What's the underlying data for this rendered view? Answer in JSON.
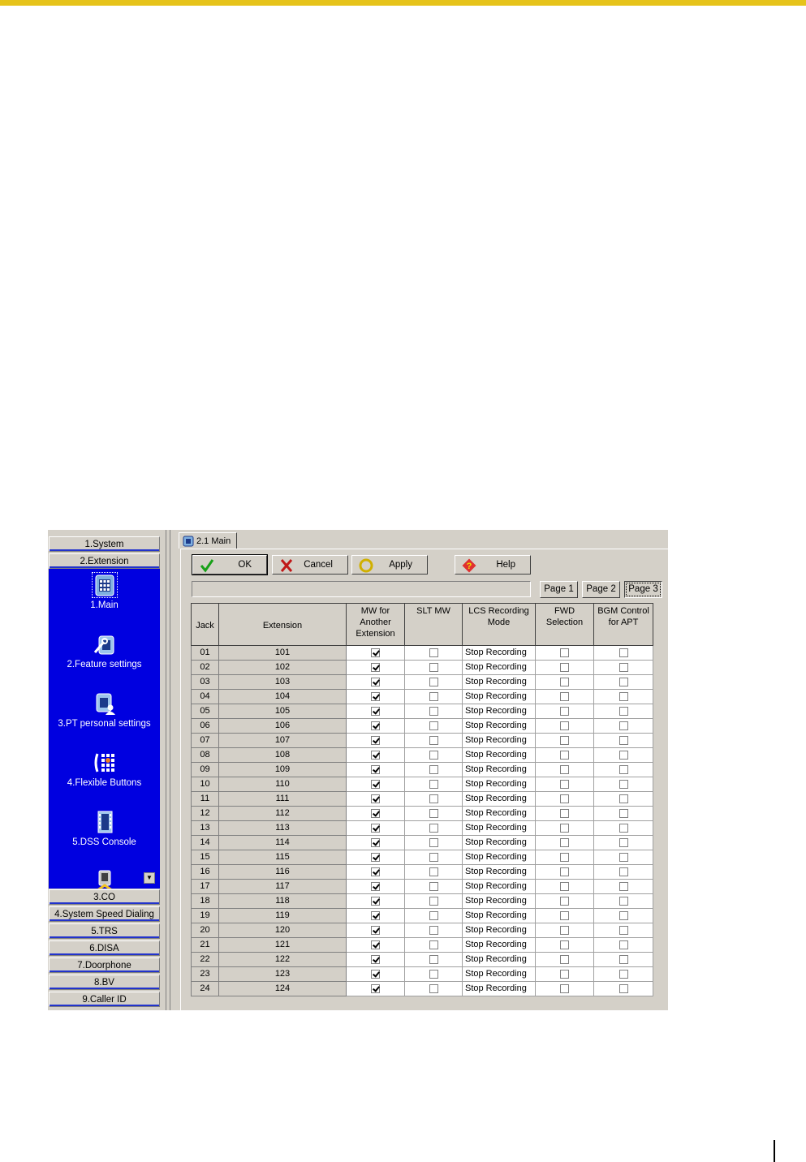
{
  "nav": {
    "top_items": [
      "1.System",
      "2.Extension"
    ],
    "sub_items": [
      "1.Main",
      "2.Feature settings",
      "3.PT personal settings",
      "4.Flexible Buttons",
      "5.DSS Console"
    ],
    "bottom_items": [
      "3.CO",
      "4.System Speed Dialing",
      "5.TRS",
      "6.DISA",
      "7.Doorphone",
      "8.BV",
      "9.Caller ID"
    ]
  },
  "tab": {
    "label": "2.1 Main"
  },
  "toolbar": {
    "ok": "OK",
    "cancel": "Cancel",
    "apply": "Apply",
    "help": "Help"
  },
  "pages": [
    "Page 1",
    "Page 2",
    "Page 3"
  ],
  "table": {
    "headers": [
      "Jack",
      "Extension",
      "MW for Another Extension",
      "SLT MW",
      "LCS Recording Mode",
      "FWD Selection",
      "BGM Control for APT"
    ],
    "rows": [
      {
        "jack": "01",
        "ext": "101",
        "mw": true,
        "slt": false,
        "lcs": "Stop Recording",
        "fwd": false,
        "bgm": false
      },
      {
        "jack": "02",
        "ext": "102",
        "mw": true,
        "slt": false,
        "lcs": "Stop Recording",
        "fwd": false,
        "bgm": false
      },
      {
        "jack": "03",
        "ext": "103",
        "mw": true,
        "slt": false,
        "lcs": "Stop Recording",
        "fwd": false,
        "bgm": false
      },
      {
        "jack": "04",
        "ext": "104",
        "mw": true,
        "slt": false,
        "lcs": "Stop Recording",
        "fwd": false,
        "bgm": false
      },
      {
        "jack": "05",
        "ext": "105",
        "mw": true,
        "slt": false,
        "lcs": "Stop Recording",
        "fwd": false,
        "bgm": false
      },
      {
        "jack": "06",
        "ext": "106",
        "mw": true,
        "slt": false,
        "lcs": "Stop Recording",
        "fwd": false,
        "bgm": false
      },
      {
        "jack": "07",
        "ext": "107",
        "mw": true,
        "slt": false,
        "lcs": "Stop Recording",
        "fwd": false,
        "bgm": false
      },
      {
        "jack": "08",
        "ext": "108",
        "mw": true,
        "slt": false,
        "lcs": "Stop Recording",
        "fwd": false,
        "bgm": false
      },
      {
        "jack": "09",
        "ext": "109",
        "mw": true,
        "slt": false,
        "lcs": "Stop Recording",
        "fwd": false,
        "bgm": false
      },
      {
        "jack": "10",
        "ext": "110",
        "mw": true,
        "slt": false,
        "lcs": "Stop Recording",
        "fwd": false,
        "bgm": false
      },
      {
        "jack": "11",
        "ext": "111",
        "mw": true,
        "slt": false,
        "lcs": "Stop Recording",
        "fwd": false,
        "bgm": false
      },
      {
        "jack": "12",
        "ext": "112",
        "mw": true,
        "slt": false,
        "lcs": "Stop Recording",
        "fwd": false,
        "bgm": false
      },
      {
        "jack": "13",
        "ext": "113",
        "mw": true,
        "slt": false,
        "lcs": "Stop Recording",
        "fwd": false,
        "bgm": false
      },
      {
        "jack": "14",
        "ext": "114",
        "mw": true,
        "slt": false,
        "lcs": "Stop Recording",
        "fwd": false,
        "bgm": false
      },
      {
        "jack": "15",
        "ext": "115",
        "mw": true,
        "slt": false,
        "lcs": "Stop Recording",
        "fwd": false,
        "bgm": false
      },
      {
        "jack": "16",
        "ext": "116",
        "mw": true,
        "slt": false,
        "lcs": "Stop Recording",
        "fwd": false,
        "bgm": false
      },
      {
        "jack": "17",
        "ext": "117",
        "mw": true,
        "slt": false,
        "lcs": "Stop Recording",
        "fwd": false,
        "bgm": false
      },
      {
        "jack": "18",
        "ext": "118",
        "mw": true,
        "slt": false,
        "lcs": "Stop Recording",
        "fwd": false,
        "bgm": false
      },
      {
        "jack": "19",
        "ext": "119",
        "mw": true,
        "slt": false,
        "lcs": "Stop Recording",
        "fwd": false,
        "bgm": false
      },
      {
        "jack": "20",
        "ext": "120",
        "mw": true,
        "slt": false,
        "lcs": "Stop Recording",
        "fwd": false,
        "bgm": false
      },
      {
        "jack": "21",
        "ext": "121",
        "mw": true,
        "slt": false,
        "lcs": "Stop Recording",
        "fwd": false,
        "bgm": false
      },
      {
        "jack": "22",
        "ext": "122",
        "mw": true,
        "slt": false,
        "lcs": "Stop Recording",
        "fwd": false,
        "bgm": false
      },
      {
        "jack": "23",
        "ext": "123",
        "mw": true,
        "slt": false,
        "lcs": "Stop Recording",
        "fwd": false,
        "bgm": false
      },
      {
        "jack": "24",
        "ext": "124",
        "mw": true,
        "slt": false,
        "lcs": "Stop Recording",
        "fwd": false,
        "bgm": false
      }
    ]
  },
  "colors": {
    "header_bar": "#e6c31a",
    "nav_panel": "#0000e0",
    "window_bg": "#d4d0c8"
  },
  "icons": {
    "ok": "check-icon",
    "cancel": "x-icon",
    "apply": "circle-icon",
    "help": "help-icon",
    "tab": "phone-icon"
  }
}
